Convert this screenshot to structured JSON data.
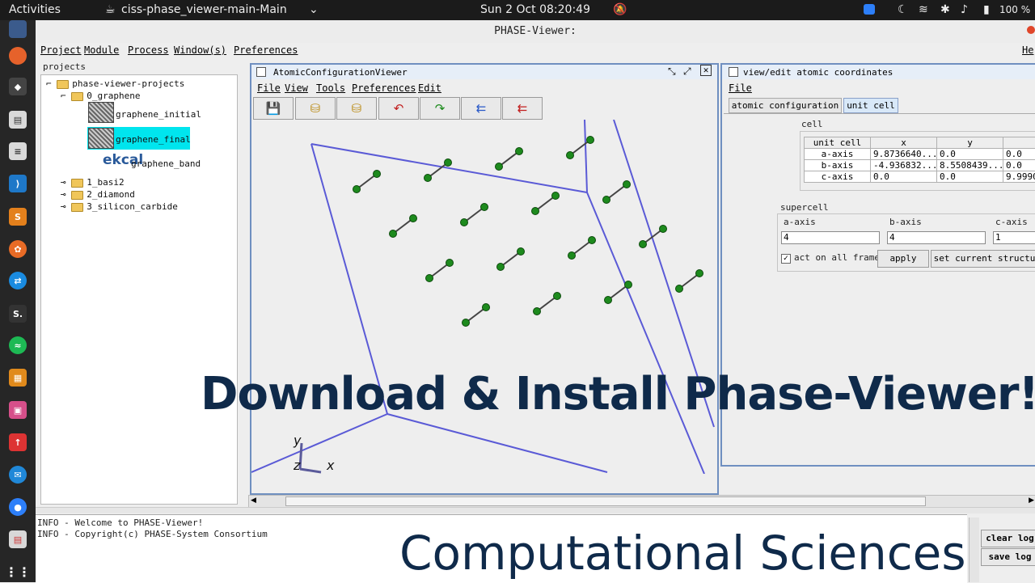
{
  "topbar": {
    "activities": "Activities",
    "app_name": "ciss-phase_viewer-main-Main",
    "clock": "Sun 2 Oct 08:20:49",
    "battery": "100 %"
  },
  "window": {
    "title": "PHASE-Viewer:",
    "help_partial": "He"
  },
  "menubar": [
    "Project",
    "Module",
    "Process",
    "Window(s)",
    "Preferences"
  ],
  "projects": {
    "label": "projects",
    "root": "phase-viewer-projects",
    "items": [
      {
        "label": "0_graphene"
      },
      {
        "label": "graphene_initial"
      },
      {
        "label": "graphene_final"
      },
      {
        "label": "graphene_band",
        "icon_text": "ekcal"
      },
      {
        "label": "1_basi2"
      },
      {
        "label": "2_diamond"
      },
      {
        "label": "3_silicon_carbide"
      }
    ]
  },
  "viewer": {
    "title": "AtomicConfigurationViewer",
    "menu": [
      "File",
      "View",
      "Tools",
      "Preferences",
      "Edit"
    ],
    "axes": {
      "y": "y",
      "z": "z",
      "x": "x"
    }
  },
  "coords": {
    "title": "view/edit atomic coordinates",
    "menu_file": "File",
    "tabs": [
      "atomic configuration",
      "unit cell"
    ],
    "cell_label": "cell",
    "table_headers": [
      "unit cell",
      "x",
      "y",
      ""
    ],
    "table_rows": [
      [
        "a-axis",
        "9.8736640...",
        "0.0",
        "0.0"
      ],
      [
        "b-axis",
        "-4.936832...",
        "8.5508439...",
        "0.0"
      ],
      [
        "c-axis",
        "0.0",
        "0.0",
        "9.9990"
      ]
    ],
    "supercell_label": "supercell",
    "supercell": [
      {
        "label": "a-axis",
        "value": "4"
      },
      {
        "label": "b-axis",
        "value": "4"
      },
      {
        "label": "c-axis",
        "value": "1"
      }
    ],
    "act_on_all": "act on all frames",
    "apply": "apply",
    "set_current": "set current structu"
  },
  "log": {
    "lines": [
      "INFO  - Welcome to PHASE-Viewer!",
      "INFO  - Copyright(c) PHASE-System Consortium"
    ],
    "clear": "clear log",
    "save": "save log"
  },
  "overlay": {
    "headline": "Download & Install Phase-Viewer!",
    "subtitle": "Computational Sciences"
  },
  "colors": {
    "headline": "#0f2a4a",
    "selection": "#00e5ee",
    "atom": "#1d8a1d",
    "cell_line": "#5a5ad6"
  }
}
